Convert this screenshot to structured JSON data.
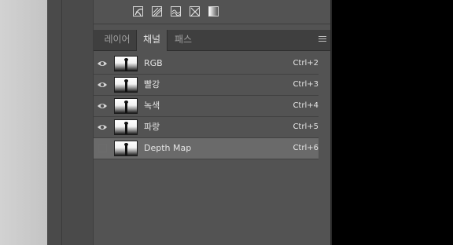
{
  "toolbar": {
    "icons": [
      "load-channel-as-selection-icon",
      "save-selection-as-channel-icon",
      "new-channel-icon",
      "delete-channel-icon",
      "mask-icon"
    ]
  },
  "tabs": [
    {
      "label": "레이어",
      "active": false
    },
    {
      "label": "채널",
      "active": true
    },
    {
      "label": "패스",
      "active": false
    }
  ],
  "channels": [
    {
      "name": "RGB",
      "shortcut": "Ctrl+2",
      "visible": true,
      "selected": false
    },
    {
      "name": "빨강",
      "shortcut": "Ctrl+3",
      "visible": true,
      "selected": false
    },
    {
      "name": "녹색",
      "shortcut": "Ctrl+4",
      "visible": true,
      "selected": false
    },
    {
      "name": "파랑",
      "shortcut": "Ctrl+5",
      "visible": true,
      "selected": false
    },
    {
      "name": "Depth Map",
      "shortcut": "Ctrl+6",
      "visible": false,
      "selected": true
    }
  ],
  "colors": {
    "panel_bg": "#535353",
    "tab_bar_bg": "#3f3f3f",
    "selected_row": "#6a6a6a",
    "text": "#e6e6e6"
  }
}
